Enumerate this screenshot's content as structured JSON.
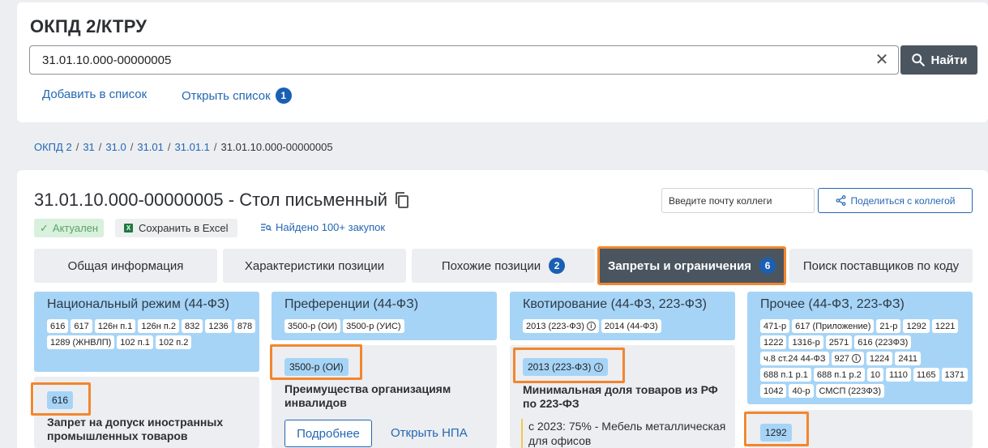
{
  "header": {
    "title": "ОКПД 2/КТРУ",
    "search_value": "31.01.10.000-00000005",
    "search_button": "Найти",
    "add_to_list": "Добавить в список",
    "open_list": "Открыть список",
    "open_list_count": "1"
  },
  "breadcrumb": [
    "ОКПД 2",
    "31",
    "31.0",
    "31.01",
    "31.01.1",
    "31.01.10.000-00000005"
  ],
  "item": {
    "title": "31.01.10.000-00000005 - Стол письменный",
    "email_placeholder": "Введите почту коллеги",
    "share_button": "Поделиться с коллегой",
    "status": "Актуален",
    "excel": "Сохранить в Excel",
    "found": "Найдено 100+ закупок"
  },
  "tabs": [
    {
      "label": "Общая информация",
      "badge": ""
    },
    {
      "label": "Характеристики позиции",
      "badge": ""
    },
    {
      "label": "Похожие позиции",
      "badge": "2"
    },
    {
      "label": "Запреты и ограничения",
      "badge": "6"
    },
    {
      "label": "Поиск поставщиков по коду",
      "badge": ""
    }
  ],
  "sections": [
    {
      "title": "Национальный режим (44-ФЗ)",
      "chips": [
        "616",
        "617",
        "126н п.1",
        "126н п.2",
        "832",
        "1236",
        "878",
        "1289 (ЖНВЛП)",
        "102 п.1",
        "102 п.2"
      ],
      "selected": "616",
      "description": "Запрет на допуск иностранных промышленных товаров"
    },
    {
      "title": "Преференции (44-ФЗ)",
      "chips": [
        "3500-р (ОИ)",
        "3500-р (УИС)"
      ],
      "selected": "3500-р (ОИ)",
      "description": "Преимущества организациям инвалидов",
      "more_button": "Подробнее",
      "npa_link": "Открыть НПА"
    },
    {
      "title": "Квотирование (44-ФЗ, 223-ФЗ)",
      "chips": [
        "2013 (223-ФЗ)",
        "2014 (44-ФЗ)"
      ],
      "selected": "2013 (223-ФЗ)",
      "description": "Минимальная доля товаров из РФ по 223-ФЗ",
      "note": "с 2023: 75% - Мебель металлическая для офисов"
    },
    {
      "title": "Прочее (44-ФЗ, 223-ФЗ)",
      "chips": [
        "471-р",
        "617 (Приложение)",
        "21-р",
        "1292",
        "1221",
        "1222",
        "1316-р",
        "2571",
        "616 (223ФЗ)",
        "ч.8 ст.24 44-ФЗ",
        "927",
        "1224",
        "2411",
        "688 п.1 р.1",
        "688 п.1 р.2",
        "10",
        "1110",
        "1165",
        "1371",
        "1042",
        "40-р",
        "СМСП (223ФЗ)"
      ],
      "selected": "1292"
    }
  ],
  "colors": {
    "accent": "#2467b3",
    "section_header": "#a6d4f7",
    "highlight": "#f2862e",
    "active_tab": "#4a5560"
  }
}
